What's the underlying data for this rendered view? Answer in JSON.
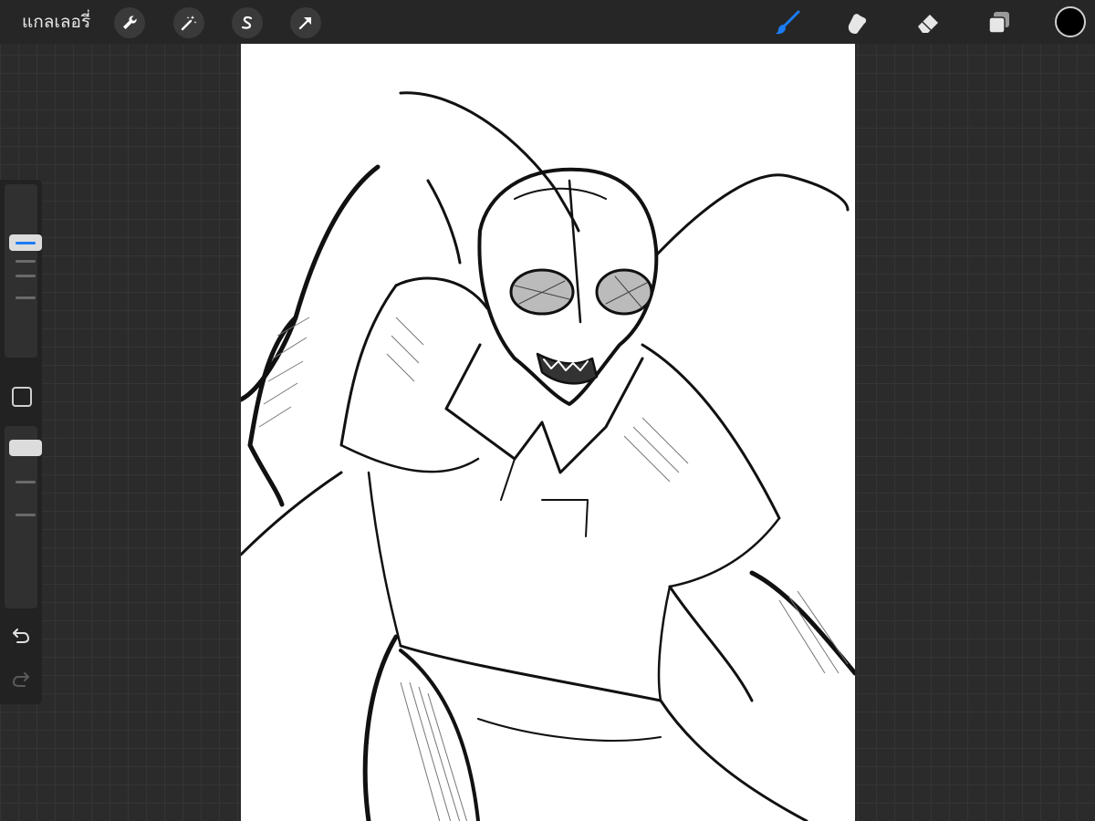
{
  "topbar": {
    "gallery_label": "แกลเลอรี่",
    "left_tools": [
      "wrench-icon",
      "magic-wand-icon",
      "selection-s-icon",
      "arrow-icon"
    ],
    "right_tools": [
      "brush-icon",
      "smudge-icon",
      "eraser-icon",
      "layers-icon"
    ],
    "active_tool": "brush-icon",
    "active_color": "#000000",
    "accent_color": "#1a7cf5"
  },
  "sidebar": {
    "brush_size_level": 0.92,
    "opacity_level": 0.3,
    "icons": [
      "modifier-square-icon",
      "undo-icon",
      "redo-icon"
    ]
  },
  "canvas": {
    "content": "sketch-illustration",
    "background": "#ffffff"
  }
}
